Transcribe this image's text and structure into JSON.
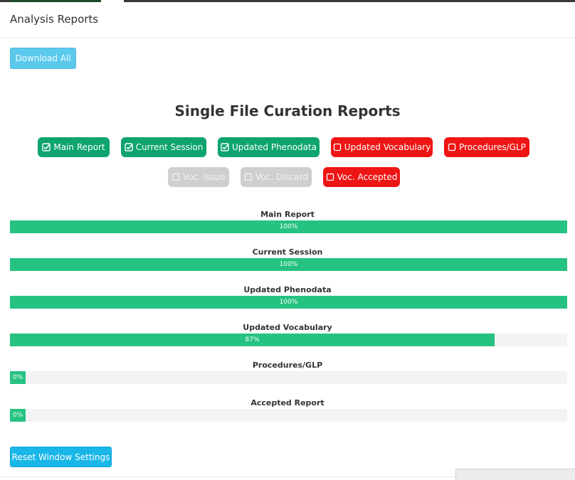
{
  "header": {
    "title": "Analysis Reports"
  },
  "actions": {
    "download_all_label": "Download All",
    "reset_label": "Reset Window Settings"
  },
  "section_title": "Single File Curation Reports",
  "toggles_row1": [
    {
      "label": "Main Report",
      "state": "checked",
      "icon": "check-square-icon"
    },
    {
      "label": "Current Session",
      "state": "checked",
      "icon": "check-square-icon"
    },
    {
      "label": "Updated Phenodata",
      "state": "checked",
      "icon": "check-square-icon"
    },
    {
      "label": "Updated Vocabulary",
      "state": "unchecked",
      "icon": "square-icon"
    },
    {
      "label": "Procedures/GLP",
      "state": "unchecked",
      "icon": "square-icon"
    }
  ],
  "toggles_row2": [
    {
      "label": "Voc. Issue",
      "state": "disabled",
      "icon": "square-icon"
    },
    {
      "label": "Voc. Discard",
      "state": "disabled",
      "icon": "square-icon"
    },
    {
      "label": "Voc. Accepted",
      "state": "unchecked",
      "icon": "square-icon"
    }
  ],
  "progress": [
    {
      "label": "Main Report",
      "percent": 100,
      "text": "100%"
    },
    {
      "label": "Current Session",
      "percent": 100,
      "text": "100%"
    },
    {
      "label": "Updated Phenodata",
      "percent": 100,
      "text": "100%"
    },
    {
      "label": "Updated Vocabulary",
      "percent": 87,
      "text": "87%"
    },
    {
      "label": "Procedures/GLP",
      "percent": 0,
      "text": "0%"
    },
    {
      "label": "Accepted Report",
      "percent": 0,
      "text": "0%"
    }
  ],
  "colors": {
    "checked": "#0da46e",
    "unchecked": "#ee1515",
    "disabled": "#cfcfcf",
    "progress_fill": "#26c281",
    "download_button": "#5bc9ec",
    "reset_button": "#19b6e8"
  }
}
